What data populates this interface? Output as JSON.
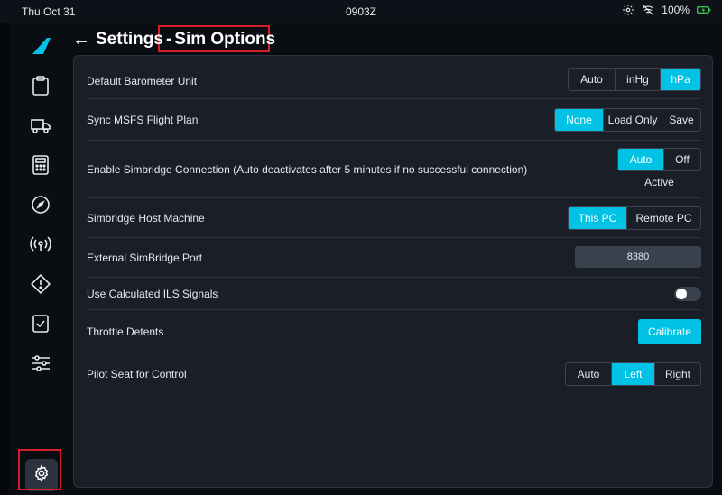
{
  "statusbar": {
    "date": "Thu Oct 31",
    "time": "0903Z",
    "battery": "100%"
  },
  "header": {
    "back_icon": "←",
    "title": "Settings",
    "separator": "-",
    "subtitle": "Sim Options"
  },
  "sidebar": {
    "items": [
      "dispatch-icon",
      "ground-icon",
      "performance-icon",
      "navigation-icon",
      "atc-icon",
      "failures-icon",
      "checklists-icon",
      "presets-icon"
    ],
    "active": "settings-icon"
  },
  "rows": {
    "baro": {
      "label": "Default Barometer Unit",
      "options": [
        "Auto",
        "inHg",
        "hPa"
      ],
      "selected": "hPa"
    },
    "sync": {
      "label": "Sync MSFS Flight Plan",
      "options": [
        "None",
        "Load Only",
        "Save"
      ],
      "selected": "None"
    },
    "simbridge": {
      "label": "Enable Simbridge Connection (Auto deactivates after 5 minutes if no successful connection)",
      "options": [
        "Auto",
        "Off"
      ],
      "selected": "Auto",
      "status": "Active"
    },
    "host": {
      "label": "Simbridge Host Machine",
      "options": [
        "This PC",
        "Remote PC"
      ],
      "selected": "This PC"
    },
    "port": {
      "label": "External SimBridge Port",
      "value": "8380"
    },
    "ils": {
      "label": "Use Calculated ILS Signals",
      "enabled": false
    },
    "throttle": {
      "label": "Throttle Detents",
      "button": "Calibrate"
    },
    "seat": {
      "label": "Pilot Seat for Control",
      "options": [
        "Auto",
        "Left",
        "Right"
      ],
      "selected": "Left"
    }
  },
  "colors": {
    "accent": "#00c2e5",
    "annotation": "#d3202a",
    "panel": "#1a1f27"
  }
}
